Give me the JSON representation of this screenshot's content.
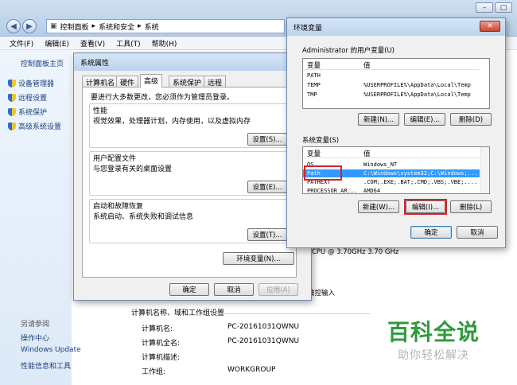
{
  "explorer": {
    "breadcrumb": [
      "控制面板",
      "系统和安全",
      "系统"
    ],
    "menu": [
      "文件(F)",
      "编辑(E)",
      "查看(V)",
      "工具(T)",
      "帮助(H)"
    ],
    "sidebar": {
      "home": "控制面板主页",
      "links": [
        "设备管理器",
        "远程设置",
        "系统保护",
        "高级系统设置"
      ],
      "see_also": "另请参阅",
      "bottom_links": [
        "操作中心",
        "Windows Update",
        "性能信息和工具"
      ]
    },
    "cpu_text": "CPU @ 3.70GHz   3.70 GHz",
    "touch_text": "被控输入",
    "section_title": "计算机名称、域和工作组设置",
    "rows": [
      {
        "label": "计算机名:",
        "value": "PC-20161031QWNU"
      },
      {
        "label": "计算机全名:",
        "value": "PC-20161031QWNU"
      },
      {
        "label": "计算机描述:",
        "value": ""
      },
      {
        "label": "工作组:",
        "value": "WORKGROUP"
      }
    ]
  },
  "sysprops": {
    "title": "系统属性",
    "tabs": [
      "计算机名",
      "硬件",
      "高级",
      "系统保护",
      "远程"
    ],
    "admin_note": "要进行大多数更改，您必须作为管理员登录。",
    "perf": {
      "title": "性能",
      "desc": "视觉效果，处理器计划，内存使用，以及虚拟内存",
      "btn": "设置(S)..."
    },
    "profile": {
      "title": "用户配置文件",
      "desc": "与您登录有关的桌面设置",
      "btn": "设置(E)..."
    },
    "startup": {
      "title": "启动和故障恢复",
      "desc": "系统启动、系统失败和调试信息",
      "btn": "设置(T)..."
    },
    "env_btn": "环境变量(N)...",
    "ok": "确定",
    "cancel": "取消",
    "apply": "应用(A)"
  },
  "envvars": {
    "title": "环境变量",
    "user_group": "Administrator 的用户变量(U)",
    "col_var": "变量",
    "col_val": "值",
    "user_vars": [
      {
        "name": "PATH",
        "value": ""
      },
      {
        "name": "TEMP",
        "value": "%USERPROFILE%\\AppData\\Local\\Temp"
      },
      {
        "name": "TMP",
        "value": "%USERPROFILE%\\AppData\\Local\\Temp"
      }
    ],
    "sys_group": "系统变量(S)",
    "sys_vars": [
      {
        "name": "OS",
        "value": "Windows_NT"
      },
      {
        "name": "Path",
        "value": "C:\\Windows\\system32;C:\\Windows;..."
      },
      {
        "name": "PATHEXT",
        "value": ".COM;.EXE;.BAT;.CMD;.VBS;.VBE;...."
      },
      {
        "name": "PROCESSOR_AR...",
        "value": "AMD64"
      }
    ],
    "new_user": "新建(N)...",
    "edit_user": "编辑(E)...",
    "delete_user": "删除(D)",
    "new_sys": "新建(W)...",
    "edit_sys": "编辑(I)...",
    "delete_sys": "删除(L)",
    "ok": "确定",
    "cancel": "取消"
  },
  "watermark": {
    "title": "百科全说",
    "subtitle": "助你轻松解决"
  },
  "colors": {
    "selection": "#3399ff",
    "highlight": "#d8202a",
    "watermark": "#2f9a3e"
  }
}
